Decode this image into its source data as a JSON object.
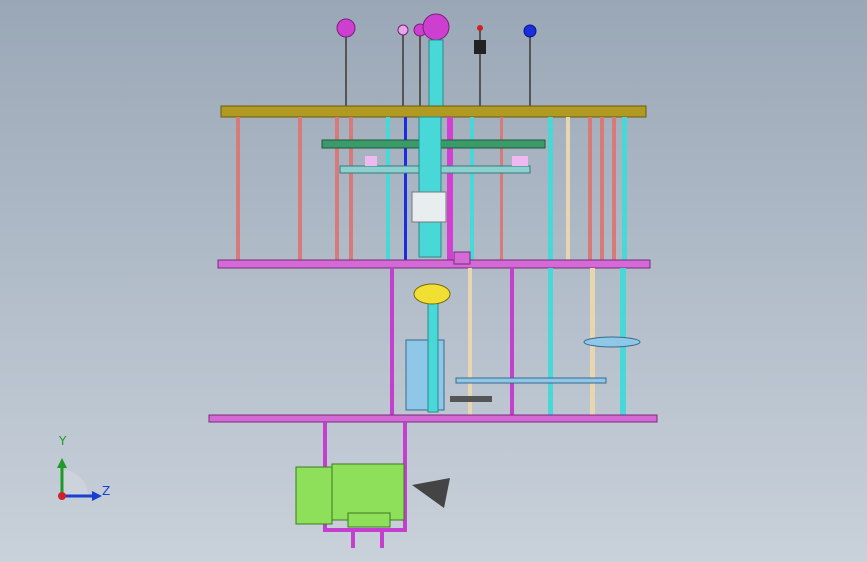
{
  "viewport": {
    "background_top": "#9aa7b6",
    "background_bottom": "#c9d1da"
  },
  "triad": {
    "y_label": "Y",
    "z_label": "Z",
    "y_color": "#1f9a2a",
    "z_color": "#1a3fd0",
    "x_color": "#d0202a"
  },
  "model": {
    "colors": {
      "top_plate": "#b09a22",
      "mid_plate": "#d36ad6",
      "lower_plate": "#d36ad6",
      "rod_pink": "#d97a7a",
      "rod_cyan": "#49d8d8",
      "rod_magenta": "#d23fd2",
      "motor_green": "#8ee05a",
      "gear_yellow": "#f1df34",
      "frame_magenta": "#c53fcf",
      "knob_magenta": "#cc3fcf",
      "knob_blue": "#1a2ee0",
      "knob_red": "#d02020"
    }
  }
}
